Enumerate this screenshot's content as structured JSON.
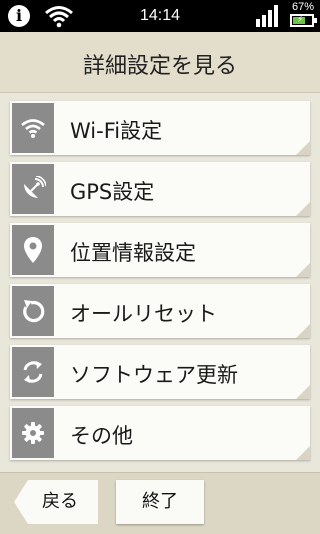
{
  "status_bar": {
    "time": "14:14",
    "battery_percent": "67%",
    "battery_level": 0.67,
    "icons": [
      "info-icon",
      "wifi-icon",
      "signal-icon",
      "battery-icon"
    ]
  },
  "header": {
    "title": "詳細設定を見る"
  },
  "menu": {
    "items": [
      {
        "label": "Wi-Fi設定",
        "icon": "wifi-icon"
      },
      {
        "label": "GPS設定",
        "icon": "satellite-icon"
      },
      {
        "label": "位置情報設定",
        "icon": "location-pin-icon"
      },
      {
        "label": "オールリセット",
        "icon": "reset-icon"
      },
      {
        "label": "ソフトウェア更新",
        "icon": "update-icon"
      },
      {
        "label": "その他",
        "icon": "gear-icon"
      }
    ]
  },
  "footer": {
    "back_label": "戻る",
    "end_label": "終了"
  },
  "colors": {
    "icon_bg": "#8b8b8b",
    "background": "#e9e6da",
    "battery_fill": "#6ac44a"
  }
}
